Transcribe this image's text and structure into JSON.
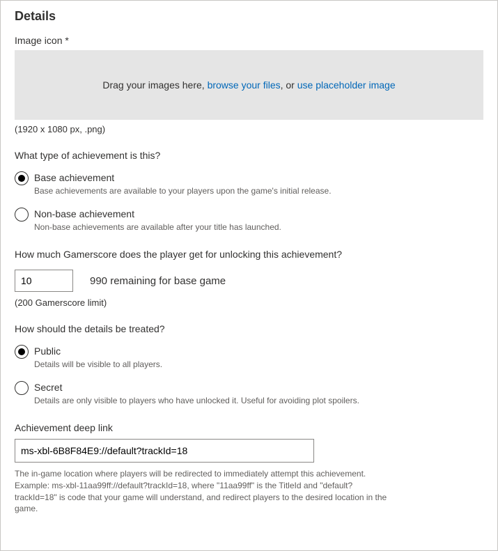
{
  "section_title": "Details",
  "image_icon": {
    "label": "Image icon *",
    "drop_text_before": "Drag your images here, ",
    "browse_link": "browse your files",
    "drop_text_mid": ", or ",
    "placeholder_link": "use placeholder image",
    "dimensions_hint": "(1920 x 1080 px, .png)"
  },
  "achievement_type": {
    "question": "What type of achievement is this?",
    "options": [
      {
        "label": "Base achievement",
        "desc": "Base achievements are available to your players upon the game's initial release.",
        "selected": true
      },
      {
        "label": "Non-base achievement",
        "desc": "Non-base achievements are available after your title has launched.",
        "selected": false
      }
    ]
  },
  "gamerscore": {
    "question": "How much Gamerscore does the player get for unlocking this achievement?",
    "value": "10",
    "remaining": "990 remaining for base game",
    "limit_hint": "(200 Gamerscore limit)"
  },
  "visibility": {
    "question": "How should the details be treated?",
    "options": [
      {
        "label": "Public",
        "desc": "Details will be visible to all players.",
        "selected": true
      },
      {
        "label": "Secret",
        "desc": "Details are only visible to players who have unlocked it. Useful for avoiding plot spoilers.",
        "selected": false
      }
    ]
  },
  "deeplink": {
    "label": "Achievement deep link",
    "value": "ms-xbl-6B8F84E9://default?trackId=18",
    "help": "The in-game location where players will be redirected to immediately attempt this achievement. Example: ms-xbl-11aa99ff://default?trackId=18, where \"11aa99ff\" is the TitleId and \"default?trackId=18\" is code that your game will understand, and redirect players to the desired location in the game."
  }
}
